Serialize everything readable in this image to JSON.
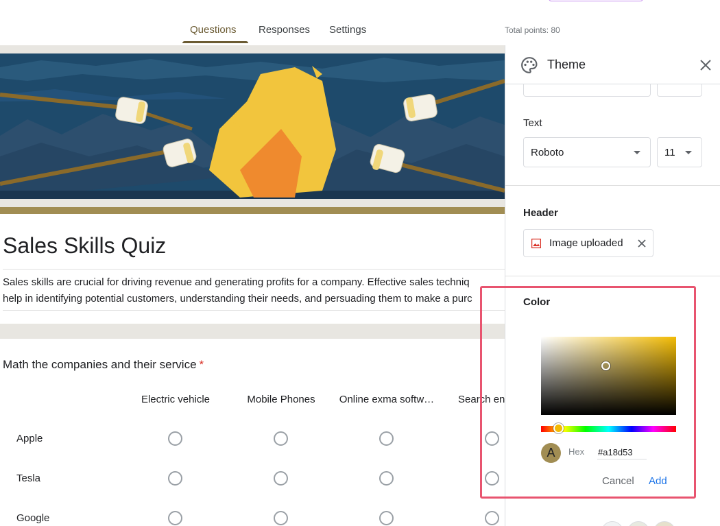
{
  "nav": {
    "tabs": [
      {
        "label": "Questions",
        "active": true
      },
      {
        "label": "Responses",
        "active": false
      },
      {
        "label": "Settings",
        "active": false
      }
    ],
    "total_points": "Total points: 80"
  },
  "form": {
    "header_image": "campfire-marshmallows-illustration",
    "title": "Sales Skills Quiz",
    "description_lines": [
      "Sales skills are crucial for driving revenue and generating profits for a company. Effective sales techniq",
      "help in identifying potential customers, understanding their needs, and persuading them to make a purc"
    ]
  },
  "question": {
    "title": "Math the companies and their service",
    "required_mark": "*",
    "columns": [
      "Electric vehicle",
      "Mobile Phones",
      "Online exma softw…",
      "Search en"
    ],
    "rows": [
      "Apple",
      "Tesla",
      "Google"
    ]
  },
  "theme_panel": {
    "title": "Theme",
    "text_section": {
      "label": "Text",
      "font": "Roboto",
      "size": "11"
    },
    "header_section": {
      "label": "Header",
      "chip_label": "Image uploaded"
    },
    "color_section": {
      "label": "Color",
      "hex_label": "Hex",
      "hex_value": "#a18d53",
      "swatch_letter": "A",
      "cancel_label": "Cancel",
      "add_label": "Add",
      "selected_hue_color": "#f2bb05"
    }
  },
  "colors": {
    "accent": "#a18d53",
    "tab_active": "#6b5b33",
    "highlight_border": "#e8546f",
    "link_blue": "#1a73e8",
    "required_red": "#d93025"
  }
}
